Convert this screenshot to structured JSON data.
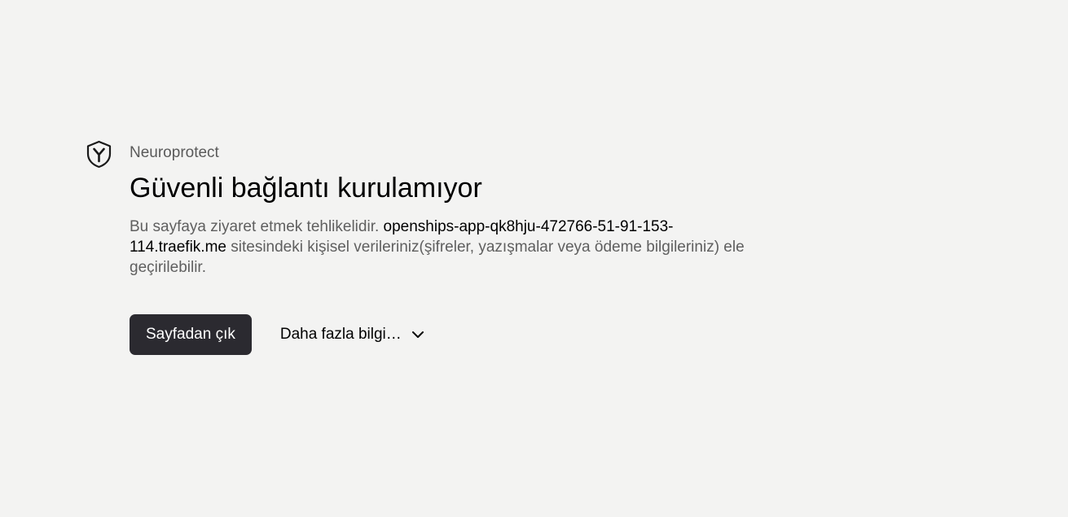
{
  "header": {
    "brand": "Neuroprotect",
    "brand_icon": "shield-icon"
  },
  "main": {
    "title": "Güvenli bağlantı kurulamıyor",
    "description": {
      "prefix": "Bu sayfaya ziyaret etmek tehlikelidir. ",
      "host": "openships-app-qk8hju-472766-51-91-153-114.traefik.me",
      "suffix": " sitesindeki kişisel verileriniz(şifreler, yazışmalar veya ödeme bilgileriniz) ele geçirilebilir."
    }
  },
  "actions": {
    "leave_label": "Sayfadan çık",
    "more_label": "Daha fazla bilgi…",
    "more_icon": "chevron-down-icon"
  },
  "colors": {
    "background": "#f3f3f2",
    "button": "#2b2a30"
  }
}
